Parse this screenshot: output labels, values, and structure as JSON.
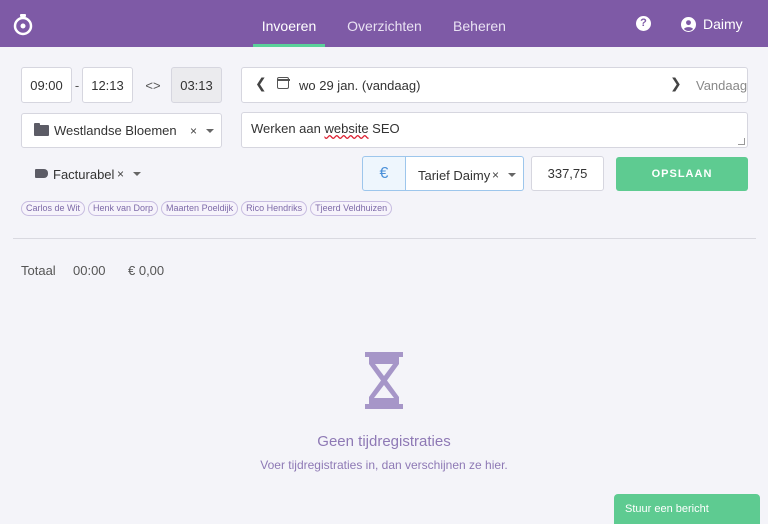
{
  "header": {
    "tabs": [
      {
        "label": "Invoeren",
        "active": true
      },
      {
        "label": "Overzichten",
        "active": false
      },
      {
        "label": "Beheren",
        "active": false
      }
    ],
    "help_icon": "question-circle-icon",
    "user_name": "Daimy"
  },
  "entry": {
    "start_time": "09:00",
    "time_separator": "-",
    "end_time": "12:13",
    "swap_icon": "<>",
    "duration": "03:13",
    "date_label": "wo 29 jan. (vandaag)",
    "today_label": "Vandaag",
    "project": "Westlandse Bloemen",
    "description_before": "Werken aan ",
    "description_misspelled": "website",
    "description_after": " SEO",
    "tag": "Facturabel",
    "currency_symbol": "€",
    "rate": "Tarief Daimy",
    "amount": "337,75",
    "save_label": "OPSLAAN",
    "clear_symbol": "×"
  },
  "people": [
    "Carlos de Wit",
    "Henk van Dorp",
    "Maarten Poeldijk",
    "Rico Hendriks",
    "Tjeerd Veldhuizen"
  ],
  "totals": {
    "label": "Totaal",
    "time": "00:00",
    "amount": "€ 0,00"
  },
  "empty_state": {
    "icon": "hourglass-icon",
    "title": "Geen tijdregistraties",
    "subtitle": "Voer tijdregistraties in, dan verschijnen ze hier."
  },
  "chat": {
    "label": "Stuur een bericht"
  },
  "colors": {
    "header": "#7e5aa6",
    "accent_green": "#5ecb91",
    "empty_state": "#8e79b5"
  }
}
